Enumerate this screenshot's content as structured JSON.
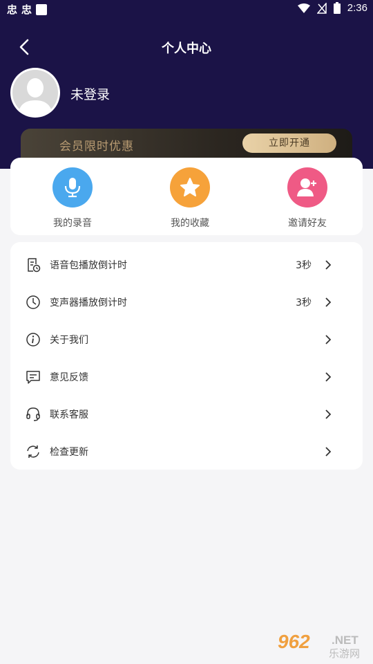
{
  "status_bar": {
    "app_icon_1": "忠",
    "app_icon_2": "忠",
    "time": "2:36"
  },
  "header": {
    "title": "个人中心"
  },
  "profile": {
    "login_text": "未登录"
  },
  "vip": {
    "text": "会员限时优惠",
    "button": "立即开通"
  },
  "quick_actions": [
    {
      "label": "我的录音",
      "icon": "microphone-icon",
      "color": "#4aa8ee"
    },
    {
      "label": "我的收藏",
      "icon": "star-icon",
      "color": "#f6a23a"
    },
    {
      "label": "邀请好友",
      "icon": "add-user-icon",
      "color": "#ef5a85"
    }
  ],
  "menu": [
    {
      "label": "语音包播放倒计时",
      "value": "3秒",
      "icon": "document-clock-icon"
    },
    {
      "label": "变声器播放倒计时",
      "value": "3秒",
      "icon": "clock-icon"
    },
    {
      "label": "关于我们",
      "value": "",
      "icon": "info-icon"
    },
    {
      "label": "意见反馈",
      "value": "",
      "icon": "chat-icon"
    },
    {
      "label": "联系客服",
      "value": "",
      "icon": "headset-icon"
    },
    {
      "label": "检查更新",
      "value": "",
      "icon": "refresh-icon"
    }
  ],
  "watermark": {
    "number": "962",
    "suffix": ".NET",
    "chinese": "乐游网"
  },
  "colors": {
    "header_bg": "#1b1347",
    "page_bg": "#f5f5f7",
    "vip_text": "#b89b72"
  }
}
